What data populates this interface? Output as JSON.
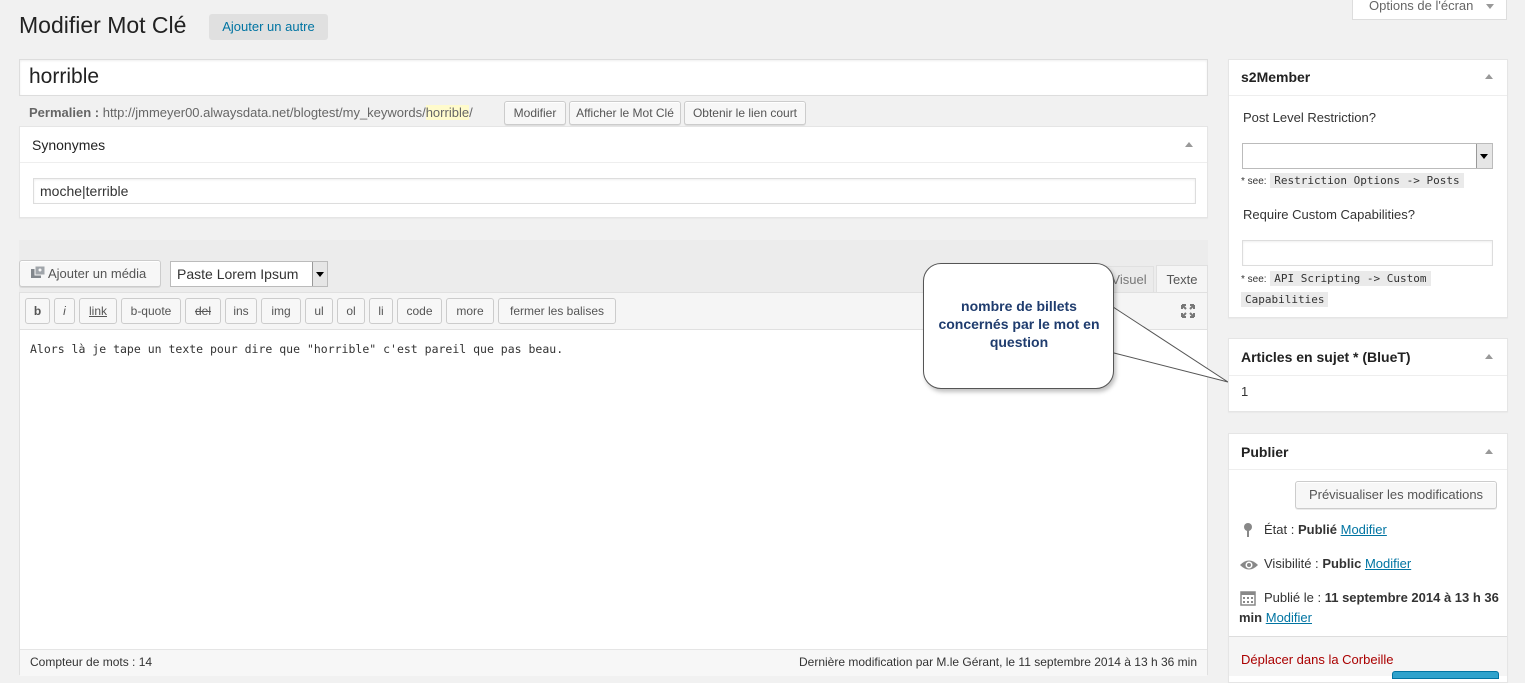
{
  "header": {
    "title": "Modifier Mot Clé",
    "add_button": "Ajouter un autre",
    "screen_options": "Options de l'écran"
  },
  "post": {
    "title": "horrible",
    "permalink_label": "Permalien :",
    "permalink_base": "http://jmmeyer00.alwaysdata.net/blogtest/my_keywords/",
    "permalink_slug": "horrible",
    "permalink_tail": "/",
    "permalink_buttons": [
      "Modifier",
      "Afficher le Mot Clé",
      "Obtenir le lien court"
    ]
  },
  "synonymes": {
    "title": "Synonymes",
    "value": "moche|terrible"
  },
  "editor": {
    "add_media": "Ajouter un média",
    "lorem_select": "Paste Lorem Ipsum",
    "tab_visual": "Visuel",
    "tab_text": "Texte",
    "quicktags": [
      "b",
      "i",
      "link",
      "b-quote",
      "del",
      "ins",
      "img",
      "ul",
      "ol",
      "li",
      "code",
      "more",
      "fermer les balises"
    ],
    "content": "Alors là je tape un texte pour dire que \"horrible\" c'est pareil que pas beau.",
    "word_count_label": "Compteur de mots : 14",
    "last_modified": "Dernière modification par M.le Gérant, le 11 septembre 2014 à 13 h 36 min"
  },
  "callout": {
    "text": "nombre de billets concernés par le mot en question"
  },
  "s2member": {
    "title": "s2Member",
    "level_label": "Post Level Restriction?",
    "see_label": "* see:",
    "see_code_1": "Restriction Options -> Posts",
    "capabilities_label": "Require Custom Capabilities?",
    "see_code_2a": "API Scripting -> Custom",
    "see_code_2b": "Capabilities"
  },
  "articles": {
    "title": "Articles en sujet * (BlueT)",
    "count": "1"
  },
  "publier": {
    "title": "Publier",
    "preview": "Prévisualiser les modifications",
    "state_label": "État :",
    "state_value": "Publié",
    "visibility_label": "Visibilité :",
    "visibility_value": "Public",
    "published_label": "Publié le :",
    "published_value_1": "11 septembre 2014 à 13 h 36",
    "published_value_2": "min",
    "edit_link": "Modifier",
    "trash": "Déplacer dans la Corbeille"
  },
  "colors": {
    "link": "#0074a2",
    "trash": "#a00",
    "slug_highlight": "#fffbcc",
    "callout_text": "#1f3c6e"
  }
}
